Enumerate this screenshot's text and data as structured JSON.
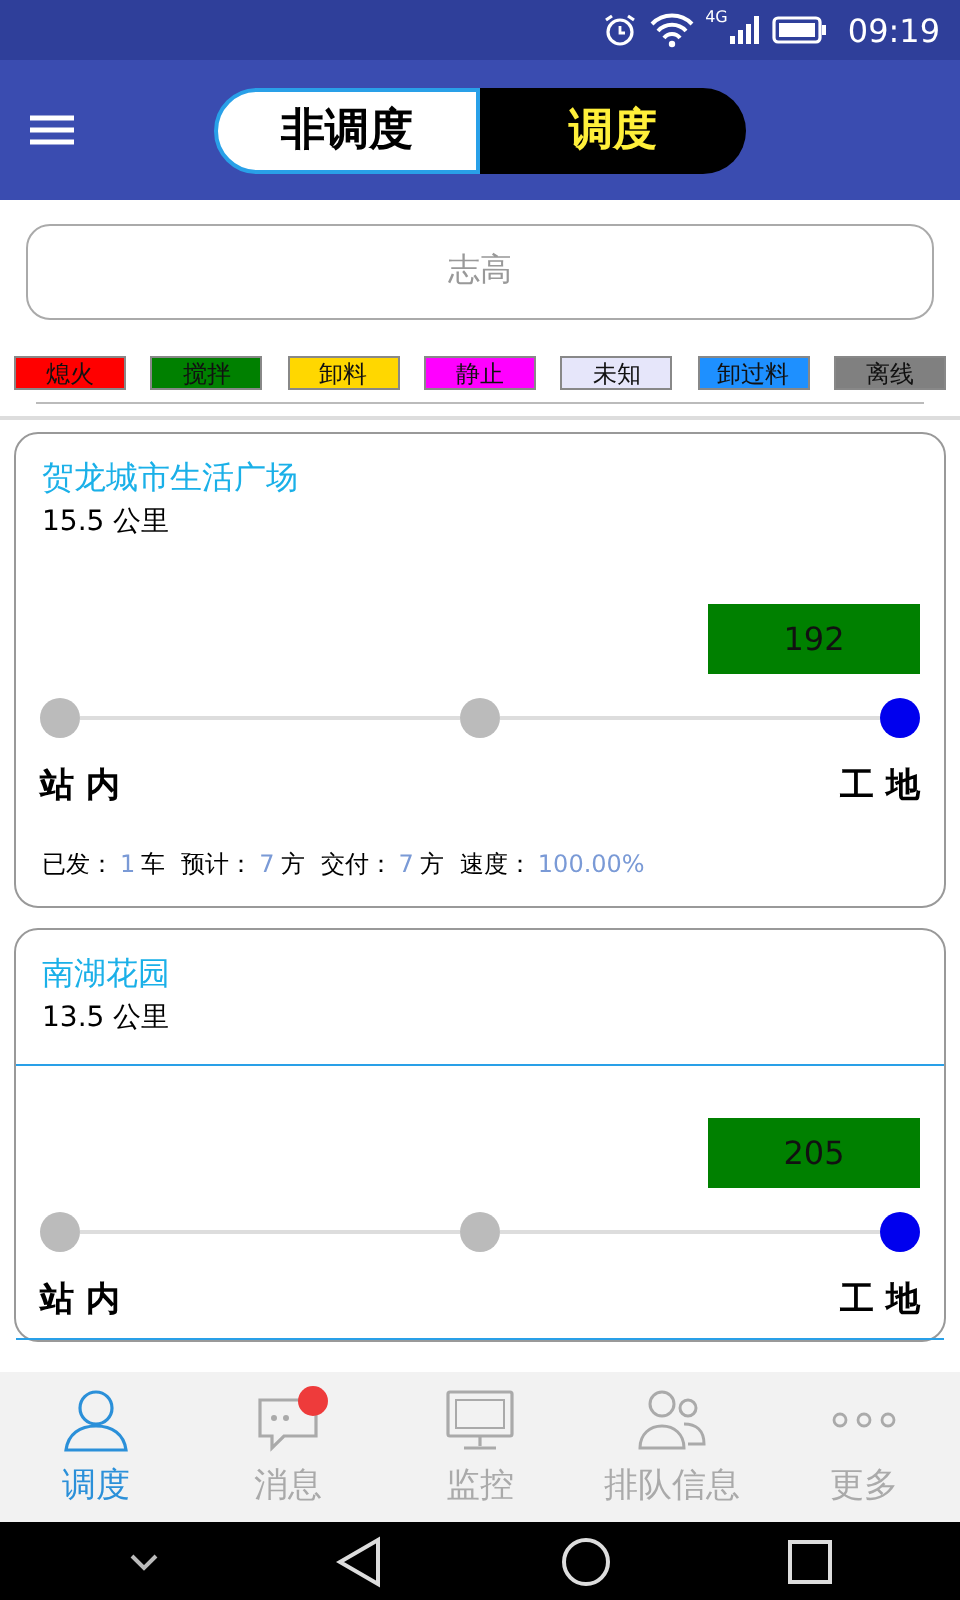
{
  "status_bar": {
    "network": "4G",
    "time": "09:19"
  },
  "tabs": [
    {
      "label": "非调度",
      "selected": false
    },
    {
      "label": "调度",
      "selected": true
    }
  ],
  "search": {
    "placeholder": "志高"
  },
  "legend": [
    {
      "label": "熄火",
      "color": "#ff0000"
    },
    {
      "label": "搅拌",
      "color": "#008000"
    },
    {
      "label": "卸料",
      "color": "#ffd700"
    },
    {
      "label": "静止",
      "color": "#ff00ff"
    },
    {
      "label": "未知",
      "color": "#e6e6fa"
    },
    {
      "label": "卸过料",
      "color": "#1e90ff"
    },
    {
      "label": "离线",
      "color": "#808080"
    }
  ],
  "sites": [
    {
      "name": "贺龙城市生活广场",
      "distance": "15.5 公里",
      "vehicle": "192",
      "selected": false,
      "stops": [
        {
          "active": false
        },
        {
          "active": false
        },
        {
          "active": true
        }
      ],
      "from": "站 内",
      "to": "工 地",
      "stats": [
        {
          "label": "已发：",
          "value": "1",
          "unit": "车"
        },
        {
          "label": "预计：",
          "value": "7",
          "unit": "方"
        },
        {
          "label": "交付：",
          "value": "7",
          "unit": "方"
        },
        {
          "label": "速度：",
          "value": "100.00%"
        }
      ]
    },
    {
      "name": "南湖花园",
      "distance": "13.5 公里",
      "vehicle": "205",
      "selected": true,
      "stops": [
        {
          "active": false
        },
        {
          "active": false
        },
        {
          "active": true
        }
      ],
      "from": "站 内",
      "to": "工 地"
    }
  ],
  "bottom_nav": [
    {
      "label": "调度",
      "selected": true,
      "badge": false
    },
    {
      "label": "消息",
      "selected": false,
      "badge": true
    },
    {
      "label": "监控",
      "selected": false,
      "badge": false
    },
    {
      "label": "排队信息",
      "selected": false,
      "badge": false
    },
    {
      "label": "更多",
      "selected": false,
      "badge": false
    }
  ]
}
